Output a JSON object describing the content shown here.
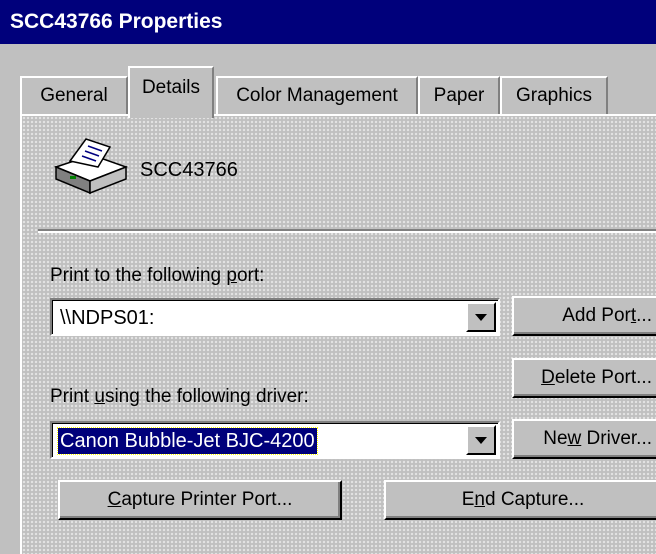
{
  "window": {
    "title": "SCC43766 Properties"
  },
  "tabs": [
    {
      "label": "General",
      "active": false
    },
    {
      "label": "Details",
      "active": true
    },
    {
      "label": "Color Management",
      "active": false
    },
    {
      "label": "Paper",
      "active": false
    },
    {
      "label": "Graphics",
      "active": false
    }
  ],
  "printer": {
    "name": "SCC43766",
    "icon": "printer-icon"
  },
  "port": {
    "label_before": "Print to the following ",
    "label_accel": "p",
    "label_after": "ort:",
    "value": "\\\\NDPS01:"
  },
  "driver": {
    "label_before": "Print ",
    "label_accel": "u",
    "label_after": "sing the following driver:",
    "value": "Canon Bubble-Jet BJC-4200"
  },
  "buttons": {
    "add_port": {
      "before": "Add Por",
      "accel": "t",
      "after": "..."
    },
    "delete_port": {
      "before": "",
      "accel": "D",
      "after": "elete Port..."
    },
    "new_driver": {
      "before": "Ne",
      "accel": "w",
      "after": " Driver..."
    },
    "capture": {
      "before": "",
      "accel": "C",
      "after": "apture Printer Port..."
    },
    "end_capture": {
      "before": "E",
      "accel": "n",
      "after": "d Capture..."
    }
  },
  "colors": {
    "title_bar": "#00007b",
    "face": "#c0c0c0",
    "selection": "#00007b"
  }
}
